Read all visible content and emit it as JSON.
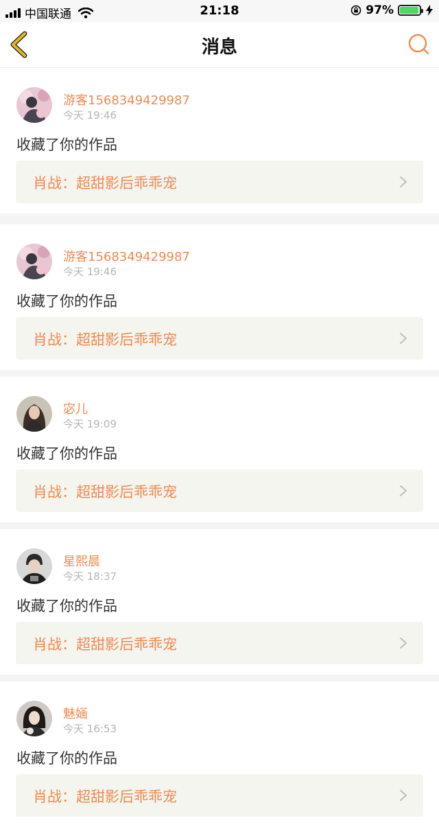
{
  "status_bar": {
    "carrier": "中国联通",
    "time": "21:18",
    "battery": "97%",
    "battery_level": 0.97
  },
  "header": {
    "title": "消息",
    "back_icon": "chevron-left-icon",
    "search_icon": "search-icon"
  },
  "colors": {
    "accent": "#f0894f",
    "back": "#e6b71e",
    "card_highlight": "#f5f5ef",
    "muted": "#b5b5b5"
  },
  "messages": [
    {
      "user": "游客1568349429987",
      "time": "今天 19:46",
      "action": "收藏了你的作品",
      "work": "肖战：超甜影后乖乖宠"
    },
    {
      "user": "游客1568349429987",
      "time": "今天 19:46",
      "action": "收藏了你的作品",
      "work": "肖战：超甜影后乖乖宠"
    },
    {
      "user": "宓儿",
      "time": "今天 19:09",
      "action": "收藏了你的作品",
      "work": "肖战：超甜影后乖乖宠"
    },
    {
      "user": "星熙晨",
      "time": "今天 18:37",
      "action": "收藏了你的作品",
      "work": "肖战：超甜影后乖乖宠"
    },
    {
      "user": "魅婳",
      "time": "今天 16:53",
      "action": "收藏了你的作品",
      "work": "肖战：超甜影后乖乖宠"
    }
  ]
}
